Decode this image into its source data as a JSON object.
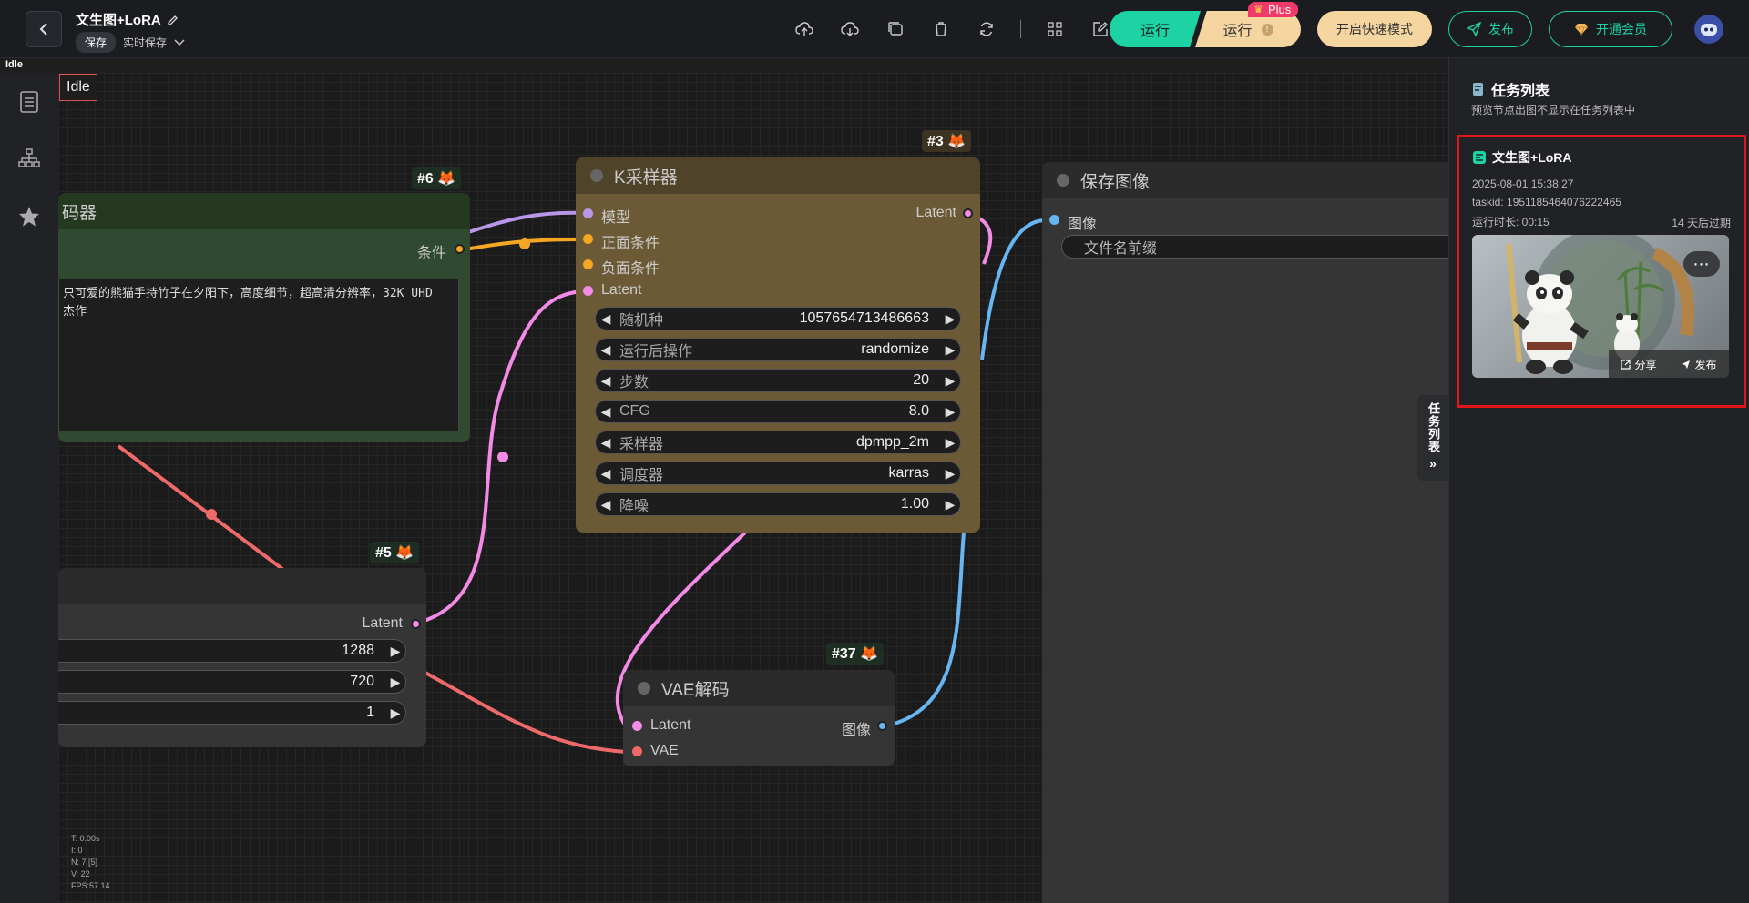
{
  "header": {
    "title": "文生图+LoRA",
    "save_label": "保存",
    "autosave_label": "实时保存",
    "run_label": "运行",
    "run_plus_label": "运行",
    "plus_badge": "Plus",
    "fast_mode_label": "开启快速模式",
    "publish_label": "发布",
    "member_label": "开通会员"
  },
  "status": {
    "idle_strip": "Idle",
    "idle_badge": "Idle"
  },
  "nodes": {
    "clip": {
      "id": "#6 🦊",
      "title": "码器",
      "output_label": "条件",
      "text": "只可爱的熊猫手持竹子在夕阳下，高度细节，超高清分辨率，32K UHD\n杰作"
    },
    "ksampler": {
      "id": "#3 🦊",
      "title": "K采样器",
      "inputs": [
        "模型",
        "正面条件",
        "负面条件",
        "Latent"
      ],
      "output_label": "Latent",
      "widgets": [
        {
          "label": "随机种",
          "value": "1057654713486663"
        },
        {
          "label": "运行后操作",
          "value": "randomize"
        },
        {
          "label": "步数",
          "value": "20"
        },
        {
          "label": "CFG",
          "value": "8.0"
        },
        {
          "label": "采样器",
          "value": "dpmpp_2m"
        },
        {
          "label": "调度器",
          "value": "karras"
        },
        {
          "label": "降噪",
          "value": "1.00"
        }
      ]
    },
    "save": {
      "title": "保存图像",
      "input_label": "图像",
      "filename_label": "文件名前缀"
    },
    "latent": {
      "id": "#5 🦊",
      "output_label": "Latent",
      "widgets": [
        {
          "value": "1288"
        },
        {
          "value": "720"
        },
        {
          "value": "1"
        }
      ]
    },
    "vae": {
      "id": "#37 🦊",
      "title": "VAE解码",
      "input_latent": "Latent",
      "input_vae": "VAE",
      "output_label": "图像"
    }
  },
  "stats": {
    "t": "T: 0.00s",
    "i": "I: 0",
    "n": "N: 7 [5]",
    "v": "V: 22",
    "fps": "FPS:57.14"
  },
  "task_panel": {
    "title": "任务列表",
    "subtitle": "预览节点出图不显示在任务列表中",
    "side_tab": "任务列表",
    "task": {
      "name": "文生图+LoRA",
      "datetime": "2025-08-01 15:38:27",
      "taskid": "taskid: 1951185464076222465",
      "duration": "运行时长: 00:15",
      "expire": "14 天后过期",
      "share_label": "分享",
      "publish_label": "发布"
    }
  },
  "colors": {
    "accent": "#1dd3a4",
    "gold": "#f5d5a0",
    "highlight_red": "#e0161b",
    "ksampler_bg": "#6b5a35",
    "clip_bg": "#2f4a30"
  }
}
